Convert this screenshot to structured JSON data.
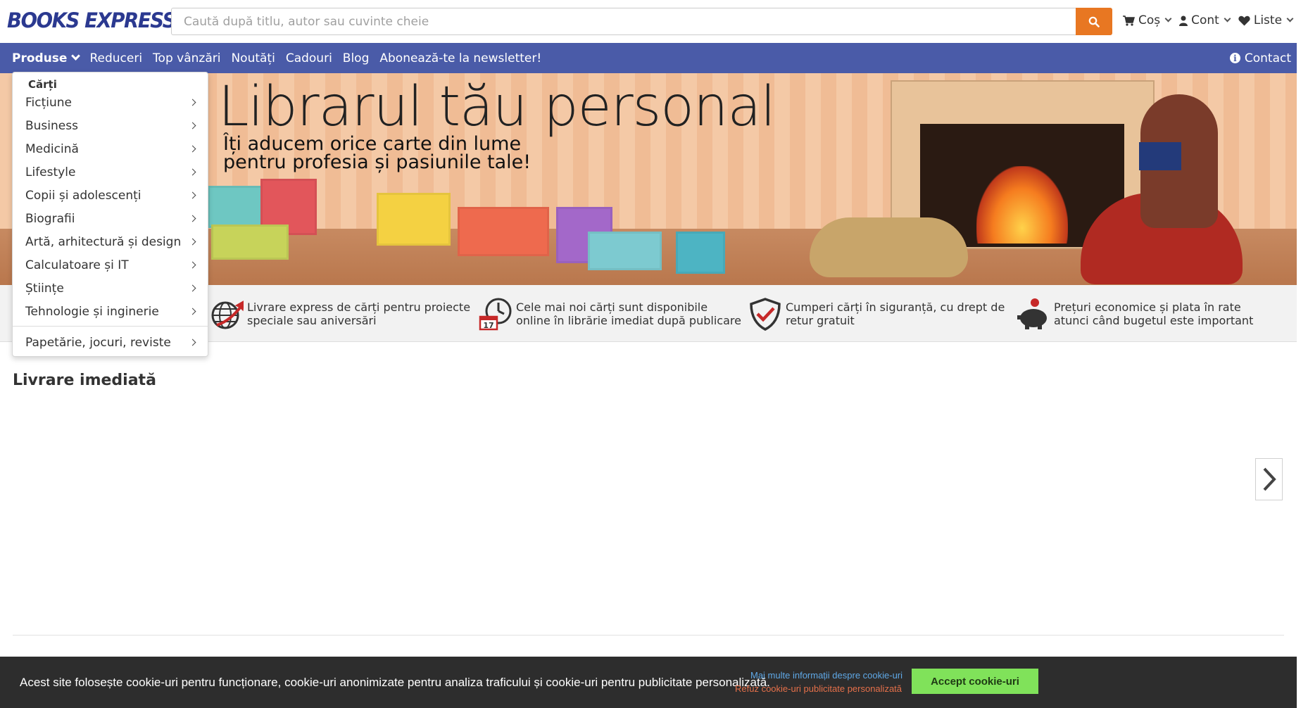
{
  "header": {
    "logo": "BOOKS EXPRESS",
    "search_placeholder": "Caută după titlu, autor sau cuvinte cheie",
    "links": [
      {
        "label": "Coș",
        "icon": "cart-icon"
      },
      {
        "label": "Cont",
        "icon": "user-icon"
      },
      {
        "label": "Liste",
        "icon": "heart-icon"
      }
    ]
  },
  "nav": {
    "items": [
      "Produse",
      "Reduceri",
      "Top vânzări",
      "Noutăți",
      "Cadouri",
      "Blog",
      "Abonează-te la newsletter!"
    ],
    "contact": "Contact"
  },
  "dropdown": {
    "header": "Cărți",
    "items": [
      "Ficțiune",
      "Business",
      "Medicină",
      "Lifestyle",
      "Copii și adolescenți",
      "Biografii",
      "Artă, arhitectură și design",
      "Calculatoare și IT",
      "Științe",
      "Tehnologie și inginerie"
    ],
    "extra": "Papetărie, jocuri, reviste"
  },
  "banner": {
    "title": "Librarul tău personal",
    "subtitle_line1": "Îți aducem orice carte din lume",
    "subtitle_line2": "pentru profesia și pasiunile tale!"
  },
  "features": [
    {
      "icon": "globe-delivery-icon",
      "text": "Livrare express de cărți pentru proiecte speciale sau aniversări"
    },
    {
      "icon": "clock-calendar-icon",
      "text": "Cele mai noi cărți sunt disponibile online în librărie imediat după publicare",
      "calendar_day": "17"
    },
    {
      "icon": "shield-check-icon",
      "text": "Cumperi cărți în siguranță, cu drept de retur gratuit"
    },
    {
      "icon": "piggy-bank-icon",
      "text": "Prețuri economice și plata în rate atunci când bugetul este important"
    }
  ],
  "main": {
    "section_title": "Livrare imediată"
  },
  "cookie": {
    "text": "Acest site folosește cookie-uri pentru funcționare, cookie-uri anonimizate pentru analiza traficului și cookie-uri pentru publicitate personalizată.",
    "more_info": "Mai multe informații despre cookie-uri",
    "refuse": "Refuz cookie-uri publicitate personalizată",
    "accept": "Accept cookie-uri"
  },
  "colors": {
    "brand": "#2b3990",
    "nav_bg": "#4a5ba8",
    "accent": "#e87722",
    "cookie_accept": "#80e25a"
  }
}
